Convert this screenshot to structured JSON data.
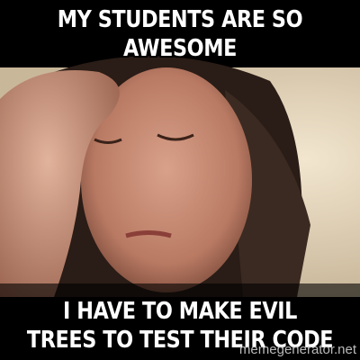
{
  "meme": {
    "top_text": "MY STUDENTS ARE SO AWESOME",
    "bottom_text": "I HAVE TO MAKE EVIL TREES TO TEST THEIR CODE",
    "watermark": "memegenerator.net"
  }
}
